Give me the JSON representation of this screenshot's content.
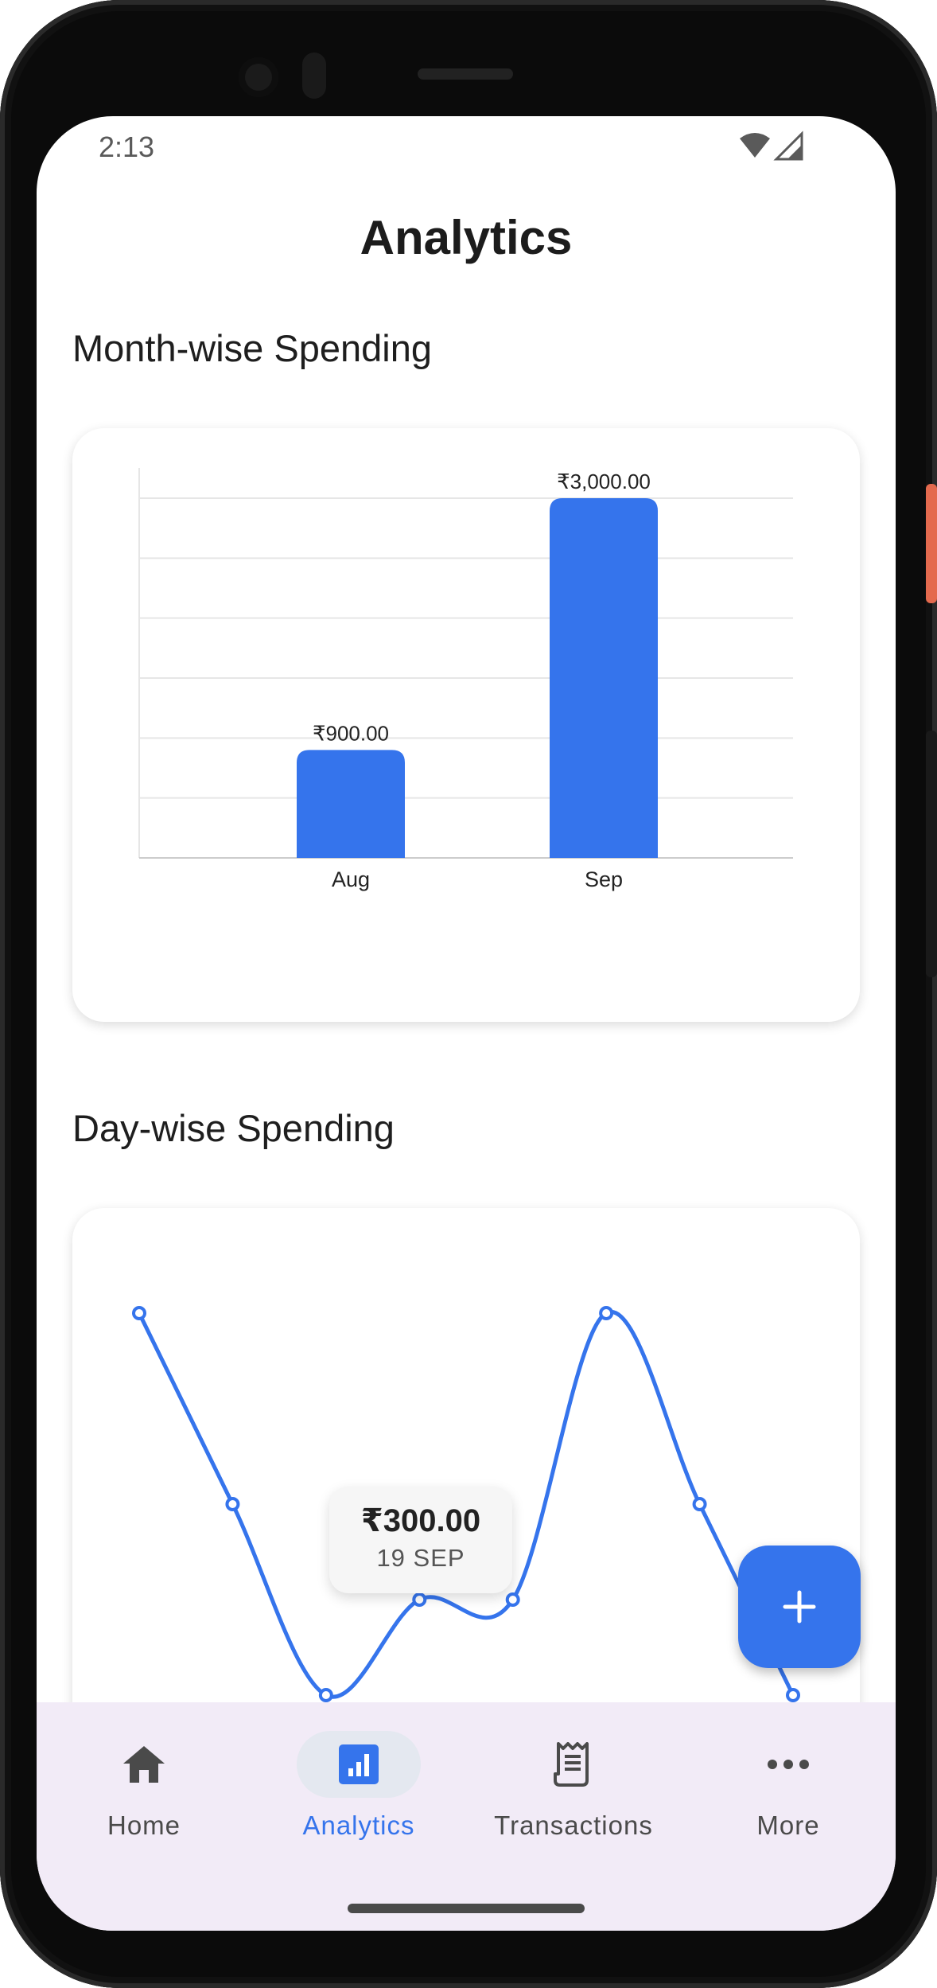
{
  "status_bar": {
    "time": "2:13"
  },
  "header": {
    "title": "Analytics"
  },
  "sections": {
    "month_title": "Month-wise Spending",
    "day_title": "Day-wise Spending"
  },
  "colors": {
    "accent": "#3574ec",
    "nav_background": "#f2ebf7",
    "active_pill": "#e4e8f0",
    "grid": "#e6e6e6"
  },
  "chart_data": [
    {
      "type": "bar",
      "categories": [
        "Aug",
        "Sep"
      ],
      "values": [
        900,
        3000
      ],
      "data_labels": [
        "₹900.00",
        "₹3,000.00"
      ],
      "grid": true,
      "series": [
        {
          "values": [
            900,
            3000
          ]
        }
      ]
    },
    {
      "type": "line",
      "y_relative": [
        1.0,
        0.5,
        0.0,
        0.25,
        0.25,
        1.0,
        0.5,
        0.0
      ],
      "grid": false
    }
  ],
  "tooltip": {
    "value": "₹300.00",
    "date": "19 SEP"
  },
  "fab": {
    "icon": "plus-icon"
  },
  "bottom_nav": {
    "items": [
      {
        "label": "Home",
        "icon": "home-icon",
        "active": false
      },
      {
        "label": "Analytics",
        "icon": "analytics-icon",
        "active": true
      },
      {
        "label": "Transactions",
        "icon": "receipt-icon",
        "active": false
      },
      {
        "label": "More",
        "icon": "more-icon",
        "active": false
      }
    ]
  }
}
